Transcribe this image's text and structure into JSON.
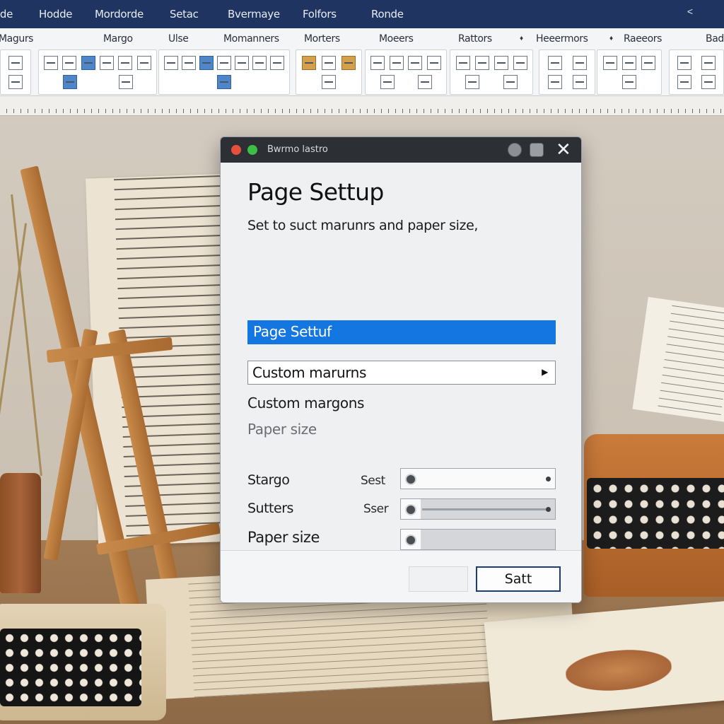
{
  "menubar": {
    "items": [
      {
        "label": "lde"
      },
      {
        "label": "Hodde"
      },
      {
        "label": "Mordorde"
      },
      {
        "label": "Setac"
      },
      {
        "label": "Bvermaye"
      },
      {
        "label": "Folfors"
      },
      {
        "label": "Ronde"
      }
    ],
    "collapse_glyph": "<"
  },
  "ribbon": {
    "groups": [
      {
        "label": "Magurs"
      },
      {
        "label": "Margo"
      },
      {
        "label": "Ulse"
      },
      {
        "label": "Momanners"
      },
      {
        "label": "Morters"
      },
      {
        "label": "Moeers"
      },
      {
        "label": "Rattors"
      },
      {
        "label": "Heeermors"
      },
      {
        "label": "Raeeors"
      },
      {
        "label": "Bad"
      }
    ]
  },
  "dialog": {
    "window_title": "Bwrmo lastro",
    "close_glyph": "✕",
    "heading": "Page Settup",
    "subtitle": "Set to suct marunrs and paper size,",
    "selected_option": "Page Settuf",
    "dropdown_value": "Custom marurns",
    "dropdown_glyph": "▶",
    "options": [
      {
        "label": "Custom margons"
      },
      {
        "label": "Paper size"
      }
    ],
    "fields": [
      {
        "label": "Stargo",
        "sublabel": "Sest"
      },
      {
        "label": "Sutters",
        "sublabel": "Sser"
      },
      {
        "label": "Paper size",
        "sublabel": ""
      }
    ],
    "primary_button": "Satt"
  },
  "colors": {
    "menubar": "#1f3460",
    "selection": "#1476e0",
    "titlebar": "#2c2f34"
  }
}
